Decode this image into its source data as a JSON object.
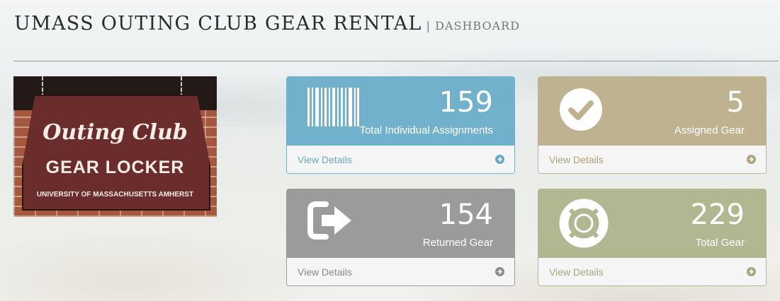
{
  "header": {
    "title": "UMASS OUTING CLUB GEAR RENTAL",
    "subtitle": "| DASHBOARD"
  },
  "sign_image": {
    "line1": "Outing Club",
    "line2": "GEAR LOCKER",
    "line3": "UNIVERSITY OF MASSACHUSETTS AMHERST"
  },
  "panels": [
    {
      "count": "159",
      "label": "Total Individual Assignments",
      "link": "View Details",
      "icon": "barcode-icon",
      "color": "#71b1cb"
    },
    {
      "count": "5",
      "label": "Assigned Gear",
      "link": "View Details",
      "icon": "check-circle-icon",
      "color": "#bfb290"
    },
    {
      "count": "154",
      "label": "Returned Gear",
      "link": "View Details",
      "icon": "sign-out-icon",
      "color": "#9b9b9b"
    },
    {
      "count": "229",
      "label": "Total Gear",
      "link": "View Details",
      "icon": "life-ring-icon",
      "color": "#b1b891"
    }
  ]
}
